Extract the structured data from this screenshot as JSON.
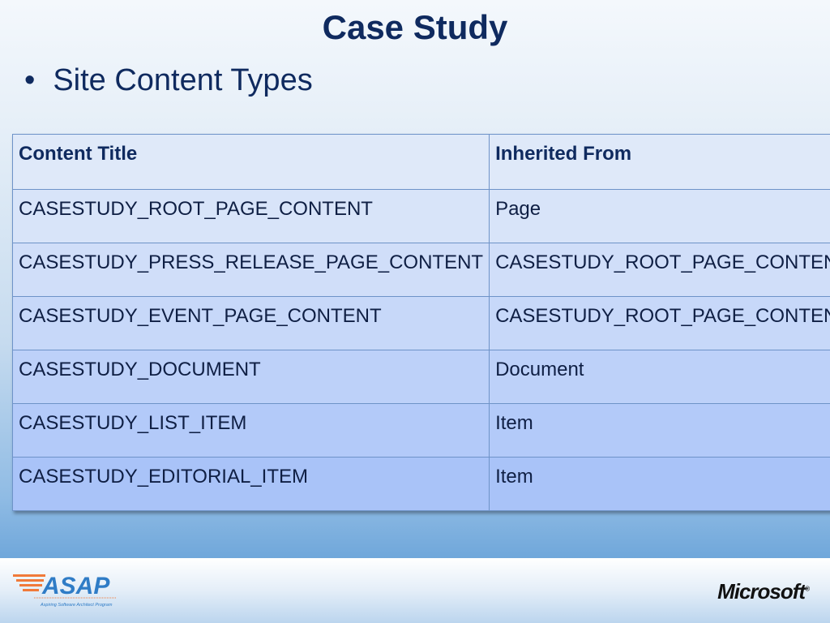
{
  "title": "Case Study",
  "bullet": "Site Content Types",
  "table": {
    "headers": [
      "Content Title",
      "Inherited From"
    ],
    "rows": [
      [
        "CASESTUDY_ROOT_PAGE_CONTENT",
        "Page"
      ],
      [
        "CASESTUDY_PRESS_RELEASE_PAGE_CONTENT",
        "CASESTUDY_ROOT_PAGE_CONTENT"
      ],
      [
        "CASESTUDY_EVENT_PAGE_CONTENT",
        "CASESTUDY_ROOT_PAGE_CONTENT"
      ],
      [
        "CASESTUDY_DOCUMENT",
        "Document"
      ],
      [
        "CASESTUDY_LIST_ITEM",
        "Item"
      ],
      [
        "CASESTUDY_EDITORIAL_ITEM",
        "Item"
      ]
    ]
  },
  "footer": {
    "asap_logo": "ASAP",
    "asap_tagline": "Aspiring Software Architect Program",
    "microsoft_logo": "Microsoft"
  }
}
